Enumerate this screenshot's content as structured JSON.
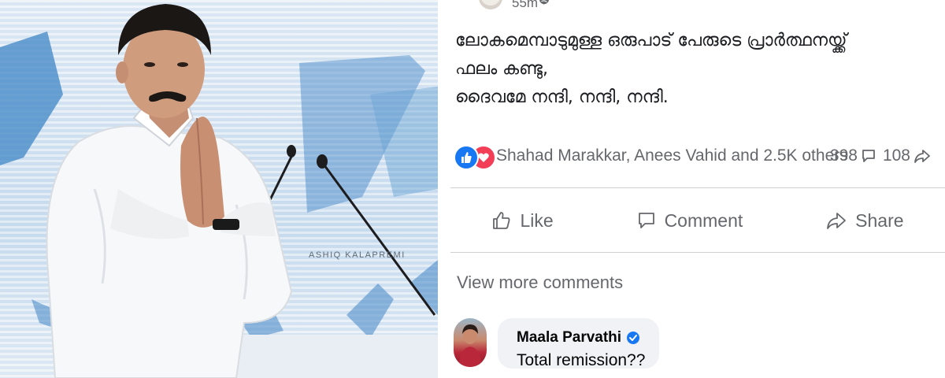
{
  "photo": {
    "watermark": "ASHIQ KALAPREMI"
  },
  "post": {
    "header": {
      "timestamp": "55m ·",
      "audience_icon": "globe-icon"
    },
    "text_lines": [
      "ലോകമെമ്പാടുമുള്ള ഒരുപാട് പേരുടെ പ്രാർത്ഥനയ്ക്ക്",
      "ഫലം കണ്ടു,",
      "ദൈവമേ നന്ദി, നന്ദി, നന്ദി."
    ],
    "reactions": {
      "icons": [
        "like-reaction-icon",
        "love-reaction-icon"
      ],
      "summary": "Shahad Marakkar, Anees Vahid and 2.5K others",
      "comments_count": "398",
      "shares_count": "108"
    },
    "actions": {
      "like": "Like",
      "comment": "Comment",
      "share": "Share"
    },
    "view_more": "View more comments",
    "comment": {
      "author": "Maala Parvathi",
      "verified": true,
      "text": "Total remission??"
    }
  },
  "colors": {
    "facebook_blue": "#1877f2",
    "love_red": "#f33e58",
    "secondary_text": "#65676b",
    "bubble_bg": "#f0f2f5"
  }
}
